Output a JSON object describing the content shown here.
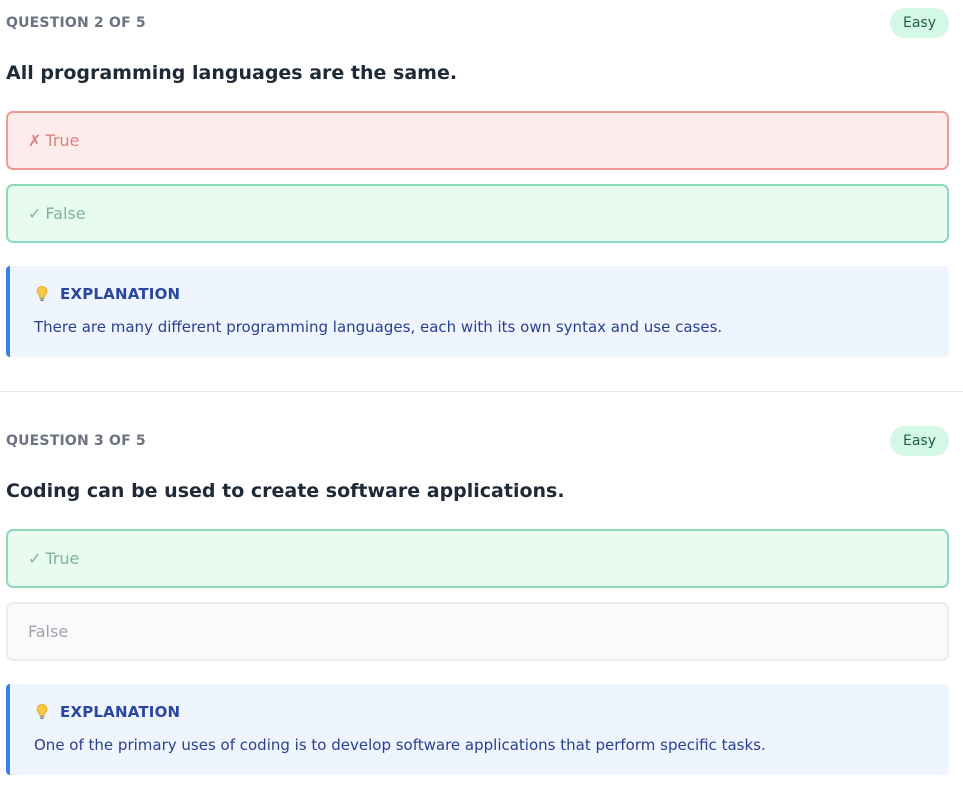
{
  "questions": [
    {
      "counter": "QUESTION 2 OF 5",
      "difficulty": "Easy",
      "text": "All programming languages are the same.",
      "options": [
        {
          "mark": "✗",
          "label": "True",
          "state": "wrong"
        },
        {
          "mark": "✓",
          "label": "False",
          "state": "correct"
        }
      ],
      "explanation": {
        "title": "EXPLANATION",
        "text": "There are many different programming languages, each with its own syntax and use cases."
      }
    },
    {
      "counter": "QUESTION 3 OF 5",
      "difficulty": "Easy",
      "text": "Coding can be used to create software applications.",
      "options": [
        {
          "mark": "✓",
          "label": "True",
          "state": "correct"
        },
        {
          "mark": "",
          "label": "False",
          "state": "neutral"
        }
      ],
      "explanation": {
        "title": "EXPLANATION",
        "text": "One of the primary uses of coding is to develop software applications that perform specific tasks."
      }
    }
  ],
  "icons": {
    "explanation": "lightbulb-icon"
  },
  "colors": {
    "wrong_bg": "#fdeceb",
    "wrong_border": "#ec9b98",
    "correct_bg": "#e7fbf0",
    "correct_border": "#8dd9b8",
    "explanation_bg": "#eef5ff",
    "explanation_accent": "#3b7fea",
    "badge_bg": "#d5f7e6"
  }
}
